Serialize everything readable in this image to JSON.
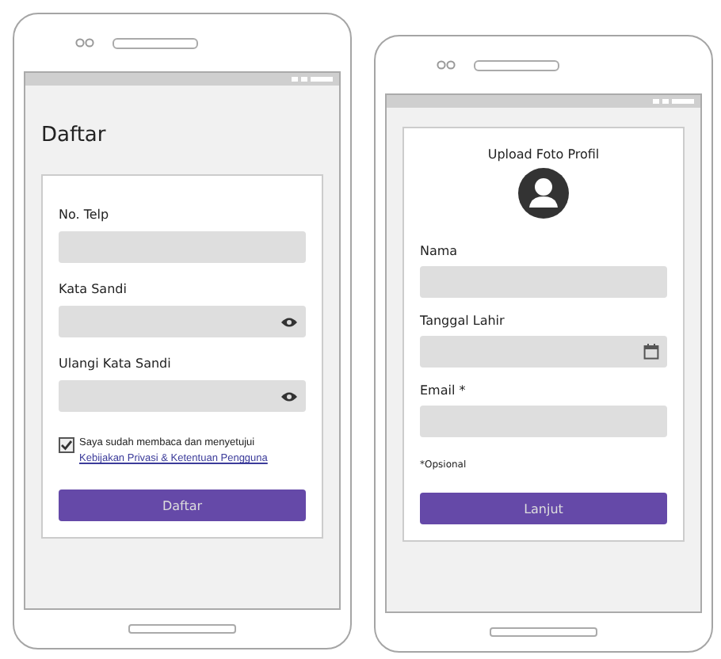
{
  "phones": [
    {
      "kind": "register",
      "title": "Daftar",
      "fields": [
        {
          "label": "No. Telp",
          "kind": "text"
        },
        {
          "label": "Kata Sandi",
          "kind": "password"
        },
        {
          "label": "Ulangi Kata Sandi",
          "kind": "password"
        }
      ],
      "consent": {
        "checked": true,
        "text": "Saya sudah membaca dan menyetujui",
        "link": "Kebijakan Privasi & Ketentuan Pengguna"
      },
      "button": "Daftar"
    },
    {
      "kind": "profile",
      "title": "Upload Foto Profil",
      "fields": [
        {
          "label": "Nama",
          "kind": "text"
        },
        {
          "label": "Tanggal Lahir",
          "kind": "date"
        },
        {
          "label": "Email *",
          "kind": "text"
        }
      ],
      "note": "*Opsional",
      "button": "Lanjut"
    }
  ]
}
